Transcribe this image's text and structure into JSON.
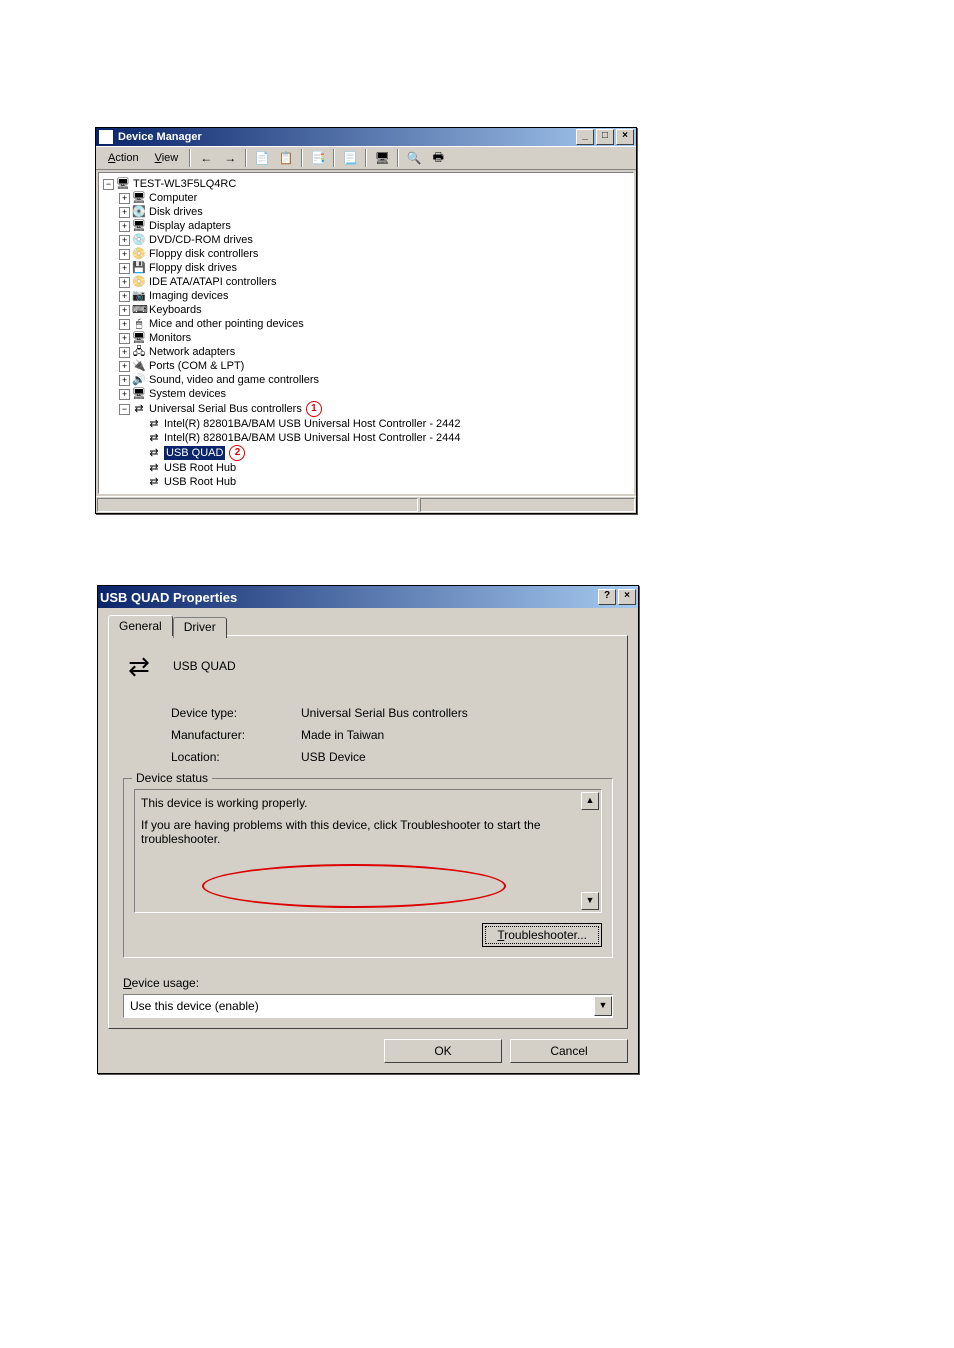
{
  "devmgr": {
    "title": "Device Manager",
    "menu": {
      "action": "Action",
      "view": "View"
    },
    "toolbar_icons": [
      "back",
      "forward",
      "sep",
      "up-tree",
      "show-hidden",
      "sep",
      "properties",
      "sep",
      "refresh",
      "sep",
      "remove",
      "sep",
      "scan",
      "print"
    ],
    "tree": {
      "root": "TEST-WL3F5LQ4RC",
      "categories": [
        {
          "label": "Computer",
          "icon": "🖥"
        },
        {
          "label": "Disk drives",
          "icon": "💽"
        },
        {
          "label": "Display adapters",
          "icon": "🖥"
        },
        {
          "label": "DVD/CD-ROM drives",
          "icon": "💿"
        },
        {
          "label": "Floppy disk controllers",
          "icon": "📀"
        },
        {
          "label": "Floppy disk drives",
          "icon": "💾"
        },
        {
          "label": "IDE ATA/ATAPI controllers",
          "icon": "📀"
        },
        {
          "label": "Imaging devices",
          "icon": "📷"
        },
        {
          "label": "Keyboards",
          "icon": "⌨"
        },
        {
          "label": "Mice and other pointing devices",
          "icon": "🖱"
        },
        {
          "label": "Monitors",
          "icon": "🖥"
        },
        {
          "label": "Network adapters",
          "icon": "🖧"
        },
        {
          "label": "Ports (COM & LPT)",
          "icon": "🔌"
        },
        {
          "label": "Sound, video and game controllers",
          "icon": "🔊"
        },
        {
          "label": "System devices",
          "icon": "🖥"
        }
      ],
      "usb": {
        "label": "Universal Serial Bus controllers",
        "children": [
          "Intel(R) 82801BA/BAM USB Universal Host Controller - 2442",
          "Intel(R) 82801BA/BAM USB Universal Host Controller - 2444",
          "USB QUAD",
          "USB Root Hub",
          "USB Root Hub"
        ],
        "selected_index": 2
      }
    },
    "annot1": "1",
    "annot2": "2"
  },
  "props": {
    "title": "USB QUAD Properties",
    "tabs": {
      "general": "General",
      "driver": "Driver"
    },
    "device_name": "USB QUAD",
    "labels": {
      "type": "Device type:",
      "mfr": "Manufacturer:",
      "loc": "Location:"
    },
    "values": {
      "type": "Universal Serial Bus controllers",
      "mfr": "Made in Taiwan",
      "loc": "USB Device"
    },
    "status_legend": "Device status",
    "status_line1": "This device is working properly.",
    "status_line2": "If you are having problems with this device, click Troubleshooter to start the troubleshooter.",
    "troubleshoot_btn": "Troubleshooter...",
    "usage_label": "Device usage:",
    "usage_value": "Use this device (enable)",
    "ok": "OK",
    "cancel": "Cancel"
  }
}
